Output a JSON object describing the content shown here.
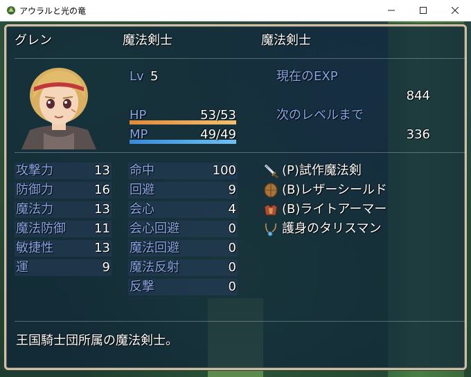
{
  "window": {
    "title": "アウラルと光の竜",
    "icon": "dragon-app-icon"
  },
  "actor": {
    "name": "グレン",
    "class": "魔法剣士",
    "nickname": "魔法剣士",
    "level_label": "Lv",
    "level": "5",
    "hp_label": "HP",
    "hp": "53/53",
    "hp_fraction": 1.0,
    "mp_label": "MP",
    "mp": "49/49",
    "mp_fraction": 1.0,
    "exp_label": "現在のEXP",
    "exp": "844",
    "next_label": "次のレベルまで",
    "next": "336",
    "profile": "王国騎士団所属の魔法剣士。"
  },
  "params": [
    {
      "label": "攻撃力",
      "value": "13"
    },
    {
      "label": "防御力",
      "value": "16"
    },
    {
      "label": "魔法力",
      "value": "13"
    },
    {
      "label": "魔法防御",
      "value": "11"
    },
    {
      "label": "敏捷性",
      "value": "13"
    },
    {
      "label": "運",
      "value": "9"
    }
  ],
  "xparams": [
    {
      "label": "命中",
      "value": "100"
    },
    {
      "label": "回避",
      "value": "9"
    },
    {
      "label": "会心",
      "value": "4"
    },
    {
      "label": "会心回避",
      "value": "0"
    },
    {
      "label": "魔法回避",
      "value": "0"
    },
    {
      "label": "魔法反射",
      "value": "0"
    },
    {
      "label": "反撃",
      "value": "0"
    }
  ],
  "equipment": [
    {
      "icon": "sword-icon",
      "name": "(P)試作魔法剣"
    },
    {
      "icon": "shield-icon",
      "name": "(B)レザーシールド"
    },
    {
      "icon": "armor-icon",
      "name": "(B)ライトアーマー"
    },
    {
      "icon": "necklace-icon",
      "name": "護身のタリスマン"
    }
  ],
  "colors": {
    "system_text": "#86a7e6",
    "hp_gauge_start": "#e08a3a",
    "hp_gauge_end": "#f0c070",
    "mp_gauge_start": "#3a8ad8",
    "mp_gauge_end": "#70c0f0"
  }
}
